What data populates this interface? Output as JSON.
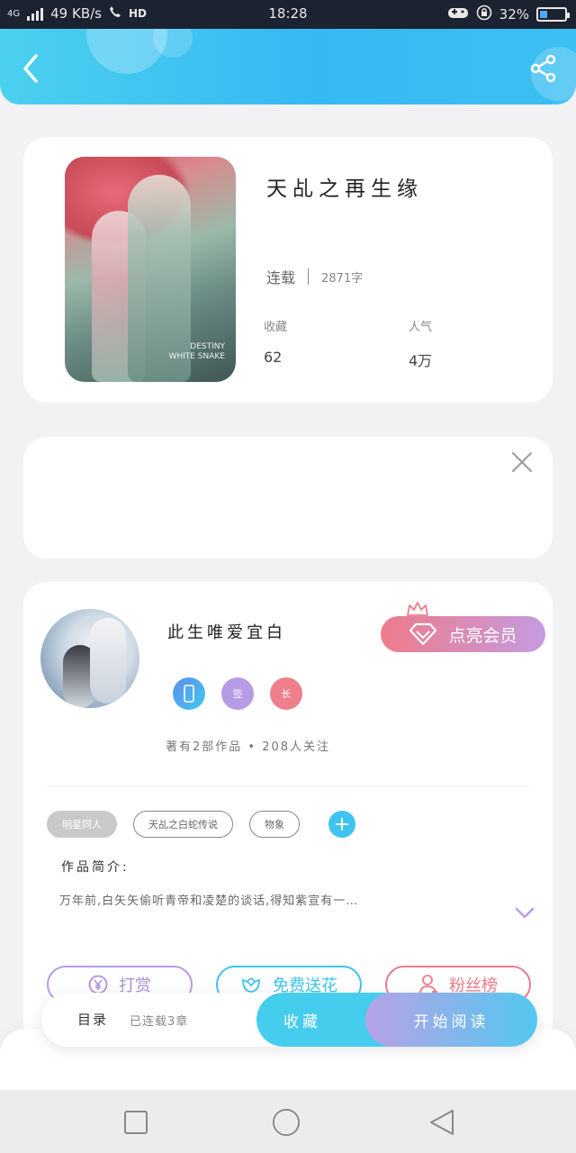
{
  "statusbar": {
    "network": "4G",
    "speed": "49 KB/s",
    "hd": "HD",
    "time": "18:28",
    "battery": "32%",
    "battery_level": 0.32
  },
  "header": {
    "back_icon": "chevron-left-icon",
    "share_icon": "share-icon"
  },
  "book": {
    "title": "天乩之再生缘",
    "status": "连载",
    "chapters": "2871字",
    "favorites_label": "收藏",
    "favorites_value": "62",
    "popularity_label": "人气",
    "popularity_value": "4万",
    "cover_caption": "DESTINY WHITE SNAKE"
  },
  "author": {
    "name": "此生唯爱宜白",
    "vip_label": "点亮会员",
    "badges": [
      "手",
      "签",
      "长"
    ],
    "stats": "著有2部作品 • 208人关注",
    "tags": [
      "明星同人",
      "天乩之白蛇传说",
      "物象"
    ],
    "intro_title": "作品简介:",
    "intro_text": "万年前,白矢矢偷听青帝和凌楚的谈话,得知紫宣有一…",
    "actions": [
      "打赏",
      "免费送花",
      "粉丝榜"
    ]
  },
  "bottombar": {
    "toc": "目录",
    "chapter_status": "已连载3章",
    "favorite": "收藏",
    "read": "开始阅读"
  },
  "colors": {
    "accent": "#3ec4ef",
    "vip_start": "#ee7b8a",
    "vip_end": "#c59be0",
    "reward": "#a98fe0",
    "flower": "#3ec4ef",
    "fans": "#ee7b8a"
  }
}
